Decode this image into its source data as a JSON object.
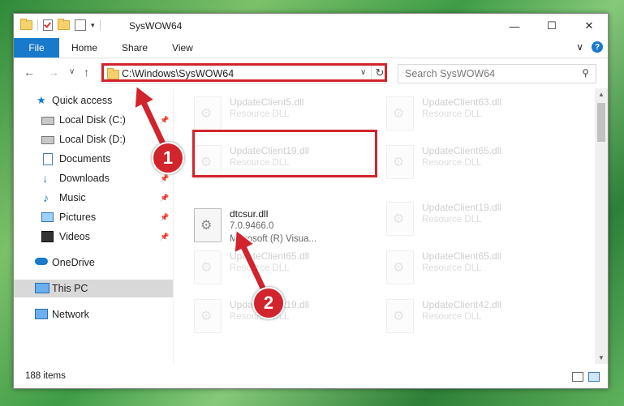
{
  "window": {
    "title": "SysWOW64"
  },
  "window_controls": {
    "minimize": "—",
    "maximize": "☐",
    "close": "✕"
  },
  "ribbon": {
    "file_tab": "File",
    "tabs": [
      "Home",
      "Share",
      "View"
    ],
    "chevron": "∨",
    "help": "?"
  },
  "nav": {
    "back": "←",
    "forward": "→",
    "recent": "∨",
    "up": "↑",
    "address": "C:\\Windows\\SysWOW64",
    "address_dropdown": "∨",
    "refresh": "↻",
    "search_placeholder": "Search SysWOW64",
    "search_icon": "⚲"
  },
  "sidebar": {
    "items": [
      {
        "label": "Quick access",
        "icon": "star-icon",
        "pinned": false
      },
      {
        "label": "Local Disk (C:)",
        "icon": "drive-icon",
        "pinned": true
      },
      {
        "label": "Local Disk (D:)",
        "icon": "drive-icon",
        "pinned": false
      },
      {
        "label": "Documents",
        "icon": "documents-icon",
        "pinned": true
      },
      {
        "label": "Downloads",
        "icon": "download-icon",
        "pinned": true
      },
      {
        "label": "Music",
        "icon": "music-icon",
        "pinned": true
      },
      {
        "label": "Pictures",
        "icon": "pictures-icon",
        "pinned": true
      },
      {
        "label": "Videos",
        "icon": "videos-icon",
        "pinned": true
      },
      {
        "label": "OneDrive",
        "icon": "cloud-icon",
        "pinned": false
      },
      {
        "label": "This PC",
        "icon": "computer-icon",
        "pinned": false,
        "selected": true
      },
      {
        "label": "Network",
        "icon": "network-icon",
        "pinned": false
      }
    ],
    "pin_glyph": "📌"
  },
  "files": [
    {
      "name": "UpdateClient5.dll",
      "line2": "Resource DLL",
      "line3": "",
      "faded": true
    },
    {
      "name": "UpdateClient63.dll",
      "line2": "Resource DLL",
      "line3": "",
      "faded": true
    },
    {
      "name": "UpdateClient19.dll",
      "line2": "Resource DLL",
      "line3": "",
      "faded": true
    },
    {
      "name": "UpdateClient65.dll",
      "line2": "Resource DLL",
      "line3": "",
      "faded": true
    },
    {
      "name": "dtcsur.dll",
      "line2": "7.0.9466.0",
      "line3": "Microsoft (R) Visua...",
      "faded": false
    },
    {
      "name": "UpdateClient19.dll",
      "line2": "Resource DLL",
      "line3": "",
      "faded": true
    },
    {
      "name": "UpdateClient65.dll",
      "line2": "Resource DLL",
      "line3": "",
      "faded": true
    },
    {
      "name": "UpdateClient65.dll",
      "line2": "Resource DLL",
      "line3": "",
      "faded": true
    },
    {
      "name": "UpdateClient19.dll",
      "line2": "Resource DLL",
      "line3": "",
      "faded": true
    },
    {
      "name": "UpdateClient42.dll",
      "line2": "Resource DLL",
      "line3": "",
      "faded": true
    }
  ],
  "status": {
    "item_count": "188 items"
  },
  "callouts": [
    "1",
    "2"
  ],
  "colors": {
    "accent": "#1979ca",
    "highlight": "#d1242c",
    "selected": "#d9d9d9"
  }
}
